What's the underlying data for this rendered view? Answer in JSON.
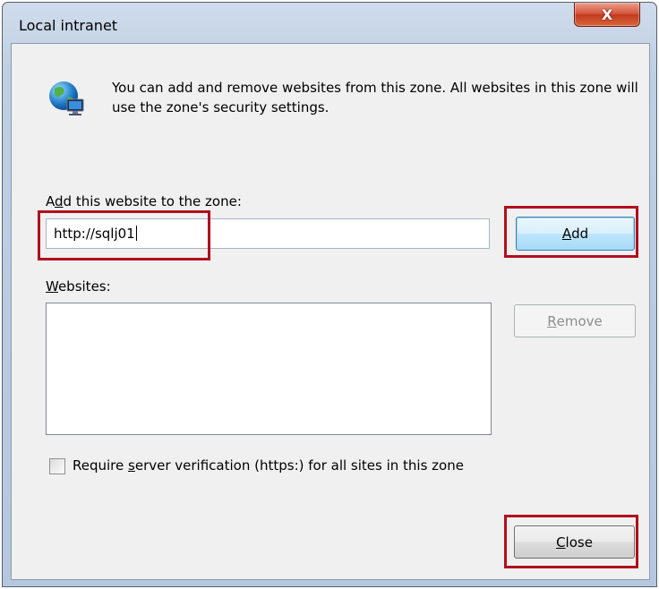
{
  "window": {
    "title": "Local intranet",
    "close_glyph": "X"
  },
  "intro": {
    "icon": "globe-computer-icon",
    "text": "You can add and remove websites from this zone. All websites in this zone will use the zone's security settings."
  },
  "add_site": {
    "label_prefix": "A",
    "label_mnemonic": "d",
    "label_suffix": "d this website to the zone:",
    "value": "http://sqlj01",
    "add_mnemonic": "A",
    "add_rest": "dd"
  },
  "websites": {
    "label_mnemonic": "W",
    "label_rest": "ebsites:",
    "items": [],
    "remove_mnemonic": "R",
    "remove_rest": "emove"
  },
  "require_https": {
    "checked": false,
    "label_prefix": "Require ",
    "label_mnemonic": "s",
    "label_suffix": "erver verification (https:) for all sites in this zone"
  },
  "footer": {
    "close_mnemonic": "C",
    "close_rest": "lose"
  },
  "colors": {
    "highlight": "#b10f1d",
    "title_bar": "#bfcfe3",
    "close_button": "#c23a1f"
  }
}
